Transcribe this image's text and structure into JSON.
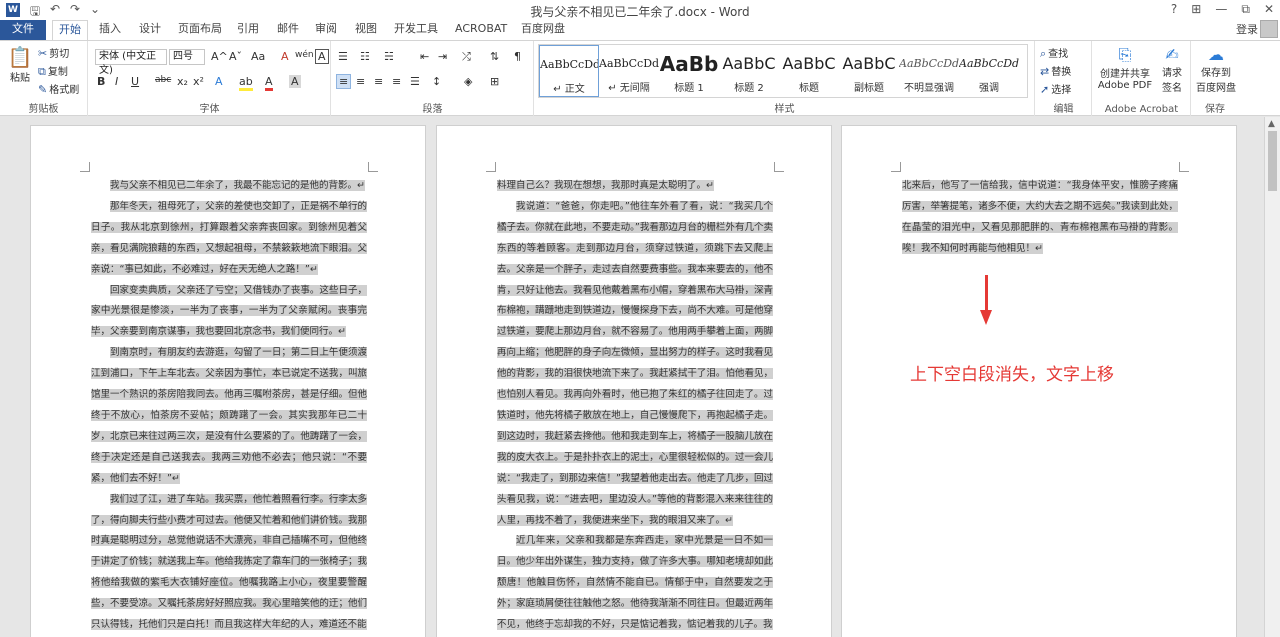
{
  "window": {
    "title": "我与父亲不相见已二年余了.docx - Word",
    "app_icon": "W",
    "controls": [
      "?",
      "⊞",
      "—",
      "⧉",
      "✕"
    ]
  },
  "qat": {
    "save": "🖫",
    "undo": "↶",
    "redo": "↷",
    "more": "⌄"
  },
  "tabs": [
    {
      "label": "文件"
    },
    {
      "label": "开始"
    },
    {
      "label": "插入"
    },
    {
      "label": "设计"
    },
    {
      "label": "页面布局"
    },
    {
      "label": "引用"
    },
    {
      "label": "邮件"
    },
    {
      "label": "审阅"
    },
    {
      "label": "视图"
    },
    {
      "label": "开发工具"
    },
    {
      "label": "ACROBAT"
    },
    {
      "label": "百度网盘"
    }
  ],
  "login_label": "登录",
  "ribbon": {
    "clipboard": {
      "paste": "粘贴",
      "cut": "剪切",
      "copy": "复制",
      "format_painter": "格式刷",
      "label": "剪贴板"
    },
    "font": {
      "name": "宋体 (中文正文)",
      "size": "四号",
      "grow": "A^",
      "shrink": "Aˇ",
      "case": "Aa",
      "clear": "A",
      "wen": "wén",
      "bold": "B",
      "italic": "I",
      "underline": "U",
      "strike": "abc",
      "sub": "x₂",
      "sup": "x²",
      "effects": "A",
      "highlight": "ab",
      "color": "A",
      "shade": "A",
      "border": "A",
      "label": "字体"
    },
    "paragraph": {
      "label": "段落"
    },
    "styles": {
      "label": "样式",
      "items": [
        {
          "sample": "AaBbCcDd",
          "name": "↵ 正文"
        },
        {
          "sample": "AaBbCcDd",
          "name": "↵ 无间隔"
        },
        {
          "sample": "AaBb",
          "name": "标题 1"
        },
        {
          "sample": "AaBbC",
          "name": "标题 2"
        },
        {
          "sample": "AaBbC",
          "name": "标题"
        },
        {
          "sample": "AaBbC",
          "name": "副标题"
        },
        {
          "sample": "AaBbCcDd",
          "name": "不明显强调"
        },
        {
          "sample": "AaBbCcDd",
          "name": "强调"
        }
      ]
    },
    "editing": {
      "find": "查找",
      "replace": "替换",
      "select": "选择",
      "label": "编辑"
    },
    "acrobat": {
      "create": "创建并共享",
      "create2": "Adobe PDF",
      "request": "请求",
      "request2": "签名",
      "label": "Adobe Acrobat"
    },
    "save": {
      "btn": "保存到",
      "btn2": "百度网盘",
      "label": "保存"
    }
  },
  "pages": [
    {
      "paras": [
        "我与父亲不相见已二年余了，我最不能忘记的是他的背影。↵",
        "那年冬天，祖母死了，父亲的差使也交卸了，正是祸不单行的日子。我从北京到徐州，打算跟着父亲奔丧回家。到徐州见着父亲，看见满院狼藉的东西，又想起祖母，不禁簌簌地流下眼泪。父亲说：“事已如此，不必难过，好在天无绝人之路！”↵",
        "回家变卖典质，父亲还了亏空；又借钱办了丧事。这些日子，家中光景很是惨淡，一半为了丧事，一半为了父亲赋闲。丧事完毕，父亲要到南京谋事，我也要回北京念书，我们便同行。↵",
        "到南京时，有朋友约去游逛，勾留了一日；第二日上午便须渡江到浦口，下午上车北去。父亲因为事忙，本已说定不送我，叫旅馆里一个熟识的茶房陪我同去。他再三嘱咐茶房，甚是仔细。但他终于不放心，怕茶房不妥帖；颇踌躇了一会。其实我那年已二十岁，北京已来往过两三次，是没有什么要紧的了。他踌躇了一会，终于决定还是自己送我去。我两三劝他不必去；他只说：“不要紧，他们去不好！”↵",
        "我们过了江，进了车站。我买票，他忙着照看行李。行李太多了，得向脚夫行些小费才可过去。他便又忙着和他们讲价钱。我那时真是聪明过分，总觉他说话不大漂亮，非自己插嘴不可，但他终于讲定了价钱；就送我上车。他给我拣定了靠车门的一张椅子；我将他给我做的紫毛大衣铺好座位。他嘱我路上小心，夜里要警醒些，不要受凉。又嘱托茶房好好照应我。我心里暗笑他的迂；他们只认得钱，托他们只是白托！而且我这样大年纪的人，难道还不能"
      ]
    },
    {
      "paras": [
        "料理自己么？我现在想想，我那时真是太聪明了。↵",
        "我说道：“爸爸，你走吧。”他往车外看了看，说：“我买几个橘子去。你就在此地，不要走动。”我看那边月台的栅栏外有几个卖东西的等着顾客。走到那边月台，须穿过铁道，须跳下去又爬上去。父亲是一个胖子，走过去自然要费事些。我本来要去的，他不肯，只好让他去。我看见他戴着黑布小帽，穿着黑布大马褂，深青布棉袍，蹒跚地走到铁道边，慢慢探身下去，尚不大难。可是他穿过铁道，要爬上那边月台，就不容易了。他用两手攀着上面，两脚再向上缩；他肥胖的身子向左微倾，显出努力的样子。这时我看见他的背影，我的泪很快地流下来了。我赶紧拭干了泪。怕他看见，也怕别人看见。我再向外看时，他已抱了朱红的橘子往回走了。过铁道时，他先将橘子散放在地上，自己慢慢爬下，再抱起橘子走。到这边时，我赶紧去搀他。他和我走到车上，将橘子一股脑儿放在我的皮大衣上。于是扑扑衣上的泥土，心里很轻松似的。过一会儿说：“我走了，到那边来信！”我望着他走出去。他走了几步，回过头看见我，说：“进去吧，里边没人。”等他的背影混入来来往往的人里，再找不着了，我便进来坐下，我的眼泪又来了。↵",
        "近几年来，父亲和我都是东奔西走，家中光景是一日不如一日。他少年出外谋生，独力支持，做了许多大事。哪知老境却如此颓唐！他触目伤怀，自然情不能自已。情郁于中，自然要发之于外；家庭琐屑便往往触他之怒。他待我渐渐不同往日。但最近两年不见，他终于忘却我的不好，只是惦记着我，惦记着我的儿子。我"
      ]
    },
    {
      "paras": [
        "北来后，他写了一信给我，信中说道：“我身体平安，惟膀子疼痛厉害，举箸提笔，诸多不便，大约大去之期不远矣。”我读到此处，在晶莹的泪光中，又看见那肥胖的、青布棉袍黑布马褂的背影。唉！我不知何时再能与他相见！↵"
      ]
    }
  ],
  "annotation": "上下空白段消失，文字上移"
}
